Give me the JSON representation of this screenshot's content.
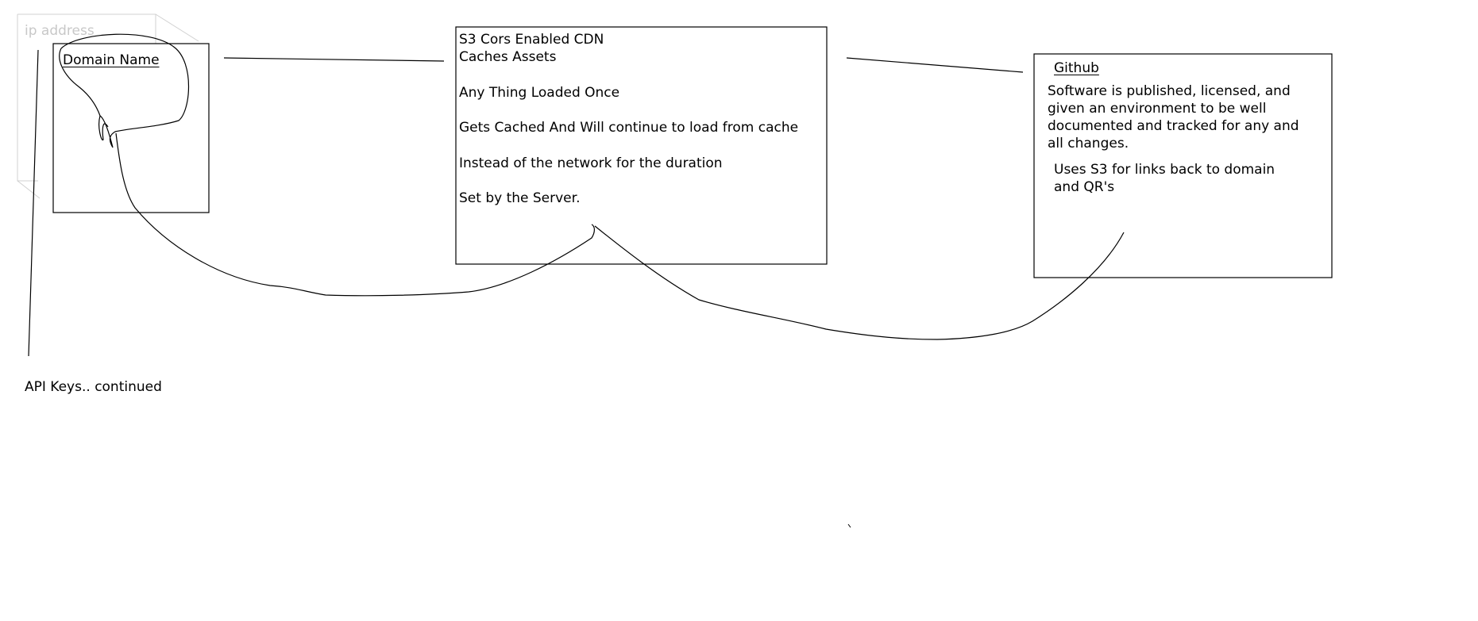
{
  "diagram": {
    "ghost_label": "ip address",
    "domain_box": {
      "label": "Domain Name"
    },
    "cdn_box": {
      "lines": [
        "S3 Cors Enabled CDN",
        "Caches Assets",
        "Any Thing Loaded Once",
        "Gets Cached And Will continue to load from cache",
        "Instead of the network for the duration",
        "Set by the Server."
      ]
    },
    "github_box": {
      "title": "Github",
      "description_lines": [
        "Software is published, licensed, and",
        "given an environment to be well",
        "documented and tracked for any and",
        "all changes."
      ],
      "note_lines": [
        "Uses S3 for links back to domain",
        "and QR's"
      ]
    },
    "footer_note": "API Keys.. continued"
  }
}
